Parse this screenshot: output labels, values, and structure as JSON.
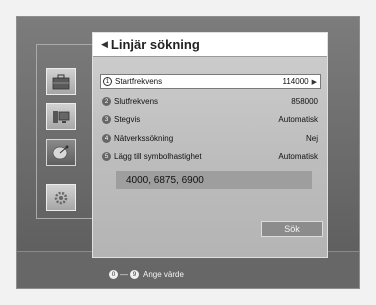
{
  "sidebar": {
    "items": [
      {
        "icon": "briefcase-icon"
      },
      {
        "icon": "computer-icon"
      },
      {
        "icon": "satellite-dish-icon",
        "active": true
      },
      {
        "icon": "gear-icon"
      }
    ]
  },
  "panel": {
    "title": "Linjär sökning",
    "rows": [
      {
        "num": "1",
        "label": "Startfrekvens",
        "value": "114000",
        "selected": true
      },
      {
        "num": "2",
        "label": "Slutfrekvens",
        "value": "858000"
      },
      {
        "num": "3",
        "label": "Stegvis",
        "value": "Automatisk"
      },
      {
        "num": "4",
        "label": "Nätverkssökning",
        "value": "Nej"
      },
      {
        "num": "5",
        "label": "Lägg till symbolhastighet",
        "value": "Automatisk"
      }
    ],
    "symbol_rates": "4000, 6875, 6900",
    "search_button": "Sök"
  },
  "hint": {
    "key_from": "0",
    "key_to": "9",
    "dash": "—",
    "text": "Ange värde"
  },
  "colors": {
    "background": "#6a6a6a",
    "panel": "#c4c4c4",
    "title_bar": "#ffffff",
    "selected_row": "#ffffff",
    "button": "#8c8c8c"
  }
}
